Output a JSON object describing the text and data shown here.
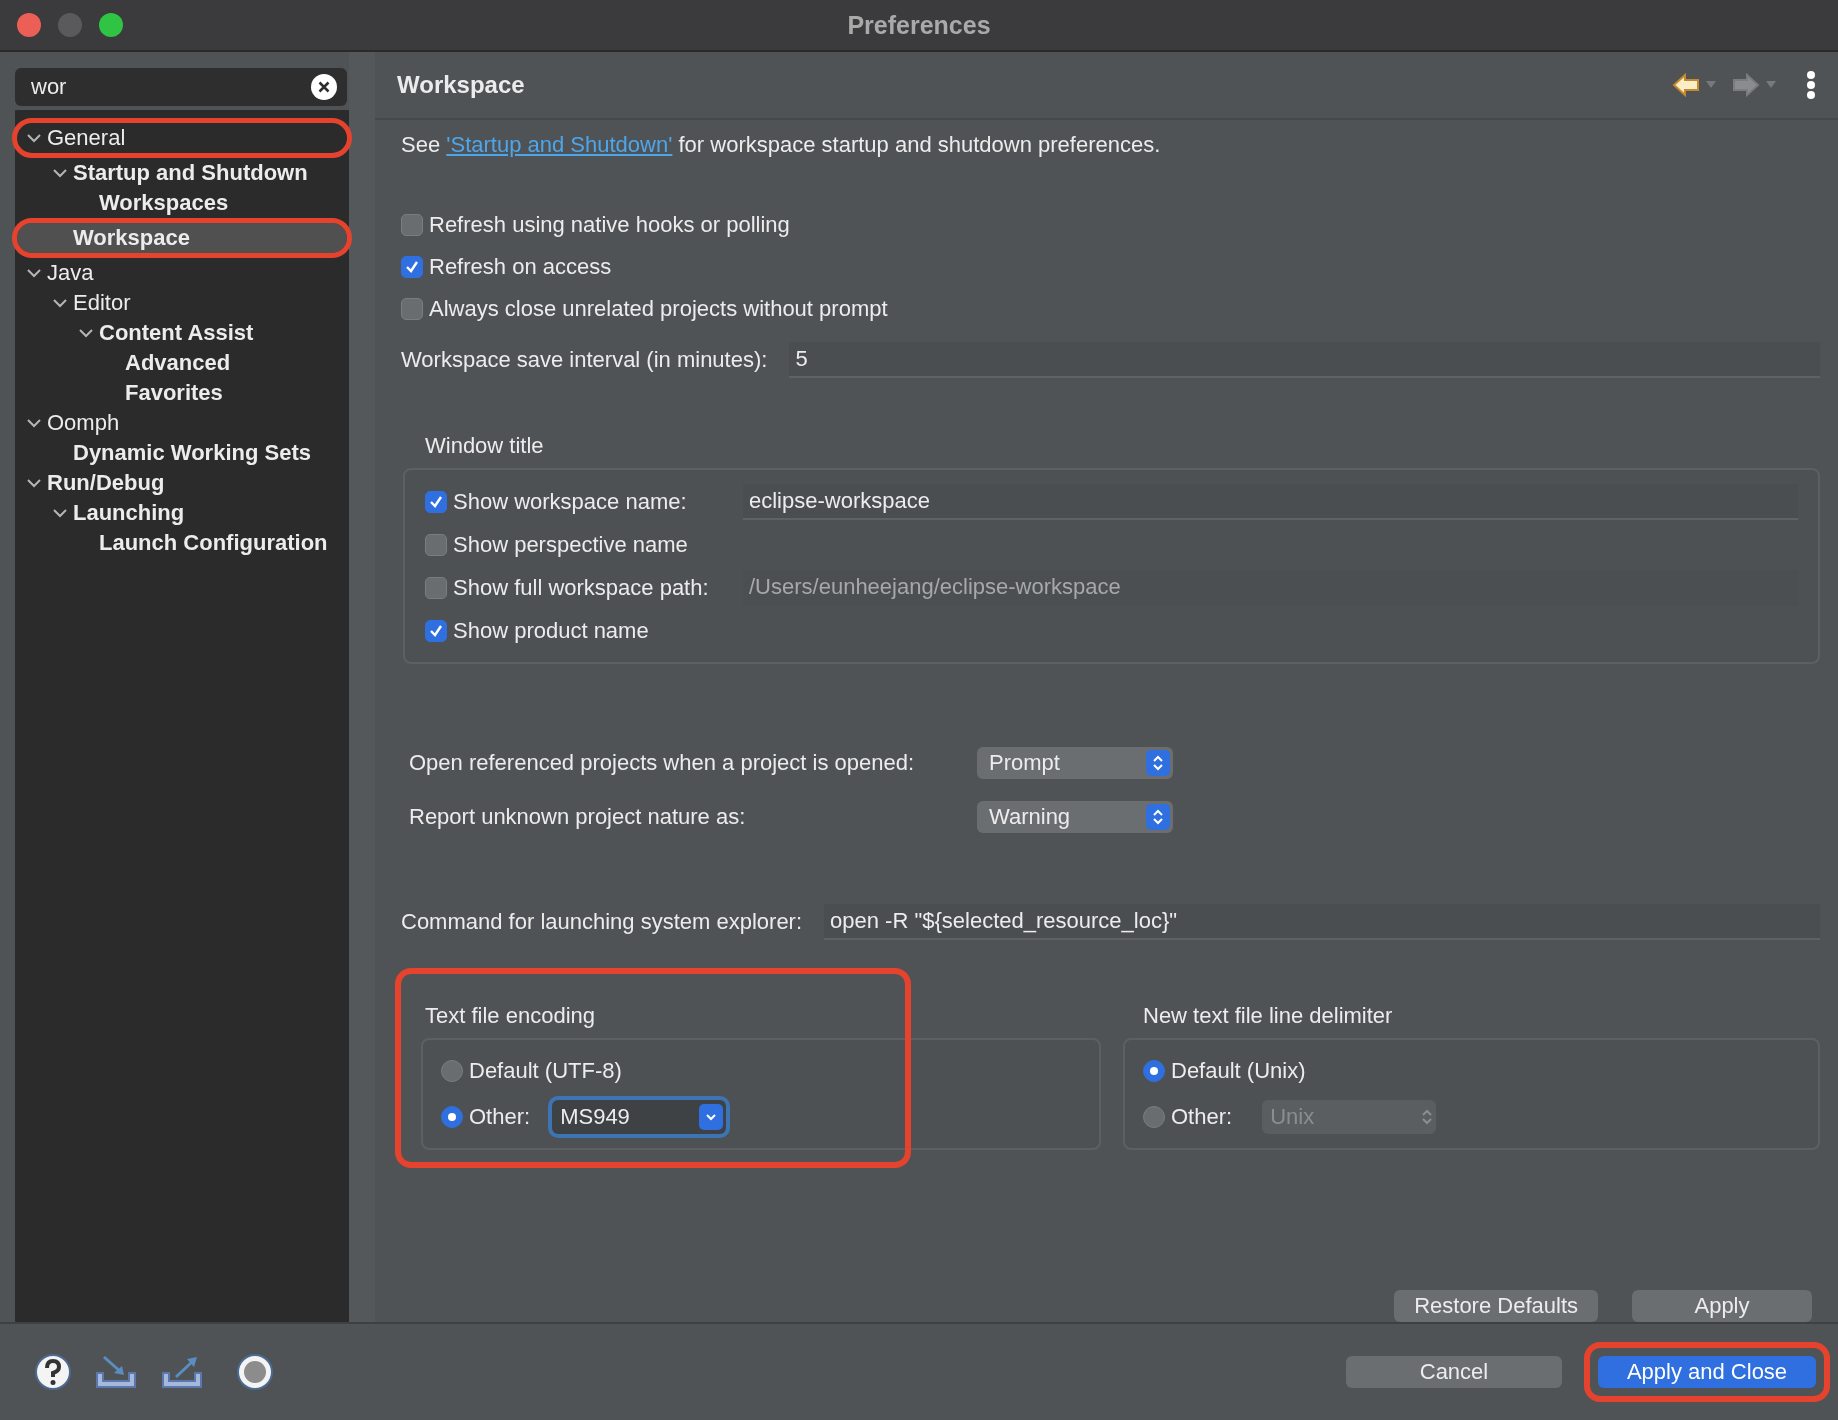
{
  "window": {
    "title": "Preferences"
  },
  "sidebar": {
    "filter": {
      "value": "wor"
    },
    "tree": [
      {
        "label": "General",
        "matched": false,
        "expanded": true,
        "selected": false,
        "annotated": true,
        "children": [
          {
            "label": "Startup and Shutdown",
            "matched": true,
            "expanded": true,
            "selected": false,
            "annotated": false,
            "children": [
              {
                "label": "Workspaces",
                "matched": true,
                "selected": false,
                "annotated": false
              }
            ]
          },
          {
            "label": "Workspace",
            "matched": true,
            "selected": true,
            "annotated": true
          }
        ]
      },
      {
        "label": "Java",
        "matched": false,
        "expanded": true,
        "selected": false,
        "annotated": false,
        "children": [
          {
            "label": "Editor",
            "matched": false,
            "expanded": true,
            "selected": false,
            "annotated": false,
            "children": [
              {
                "label": "Content Assist",
                "matched": true,
                "expanded": true,
                "selected": false,
                "annotated": false,
                "children": [
                  {
                    "label": "Advanced",
                    "matched": true,
                    "selected": false,
                    "annotated": false
                  },
                  {
                    "label": "Favorites",
                    "matched": true,
                    "selected": false,
                    "annotated": false
                  }
                ]
              }
            ]
          }
        ]
      },
      {
        "label": "Oomph",
        "matched": false,
        "expanded": true,
        "selected": false,
        "annotated": false,
        "children": [
          {
            "label": "Dynamic Working Sets",
            "matched": true,
            "selected": false,
            "annotated": false
          }
        ]
      },
      {
        "label": "Run/Debug",
        "matched": true,
        "expanded": true,
        "selected": false,
        "annotated": false,
        "children": [
          {
            "label": "Launching",
            "matched": true,
            "expanded": true,
            "selected": false,
            "annotated": false,
            "children": [
              {
                "label": "Launch Configuration",
                "matched": true,
                "selected": false,
                "annotated": false
              }
            ]
          }
        ]
      }
    ]
  },
  "page": {
    "title": "Workspace",
    "intro": {
      "before": "See ",
      "link": "'Startup and Shutdown'",
      "after": " for workspace startup and shutdown preferences."
    },
    "options": [
      {
        "label": "Refresh using native hooks or polling",
        "checked": false
      },
      {
        "label": "Refresh on access",
        "checked": true
      },
      {
        "label": "Always close unrelated projects without prompt",
        "checked": false
      }
    ],
    "save_interval": {
      "label": "Workspace save interval (in minutes):",
      "value": "5"
    },
    "window_title": {
      "heading": "Window title",
      "rows": [
        {
          "label": "Show workspace name:",
          "checked": true,
          "value": "eclipse-workspace",
          "disabled": false
        },
        {
          "label": "Show perspective name",
          "checked": false
        },
        {
          "label": "Show full workspace path:",
          "checked": false,
          "value": "/Users/eunheejang/eclipse-workspace",
          "disabled": true
        },
        {
          "label": "Show product name",
          "checked": true
        }
      ]
    },
    "selects": [
      {
        "label": "Open referenced projects when a project is opened:",
        "value": "Prompt"
      },
      {
        "label": "Report unknown project nature as:",
        "value": "Warning"
      }
    ],
    "explorer": {
      "label": "Command for launching system explorer:",
      "value": "open -R \"${selected_resource_loc}\""
    },
    "groups": [
      {
        "heading": "Text file encoding",
        "annotated": true,
        "options": [
          {
            "label": "Default (UTF-8)",
            "selected": false
          },
          {
            "label": "Other:",
            "selected": true
          }
        ],
        "combo": {
          "value": "MS949",
          "disabled": false,
          "focused": true
        }
      },
      {
        "heading": "New text file line delimiter",
        "annotated": false,
        "options": [
          {
            "label": "Default (Unix)",
            "selected": true
          },
          {
            "label": "Other:",
            "selected": false
          }
        ],
        "combo": {
          "value": "Unix",
          "disabled": true,
          "focused": false
        }
      }
    ],
    "buttons": [
      {
        "label": "Restore Defaults"
      },
      {
        "label": "Apply"
      }
    ]
  },
  "footer": {
    "buttons": [
      {
        "label": "Cancel",
        "default": false,
        "annotated": false
      },
      {
        "label": "Apply and Close",
        "default": true,
        "annotated": true
      }
    ]
  }
}
